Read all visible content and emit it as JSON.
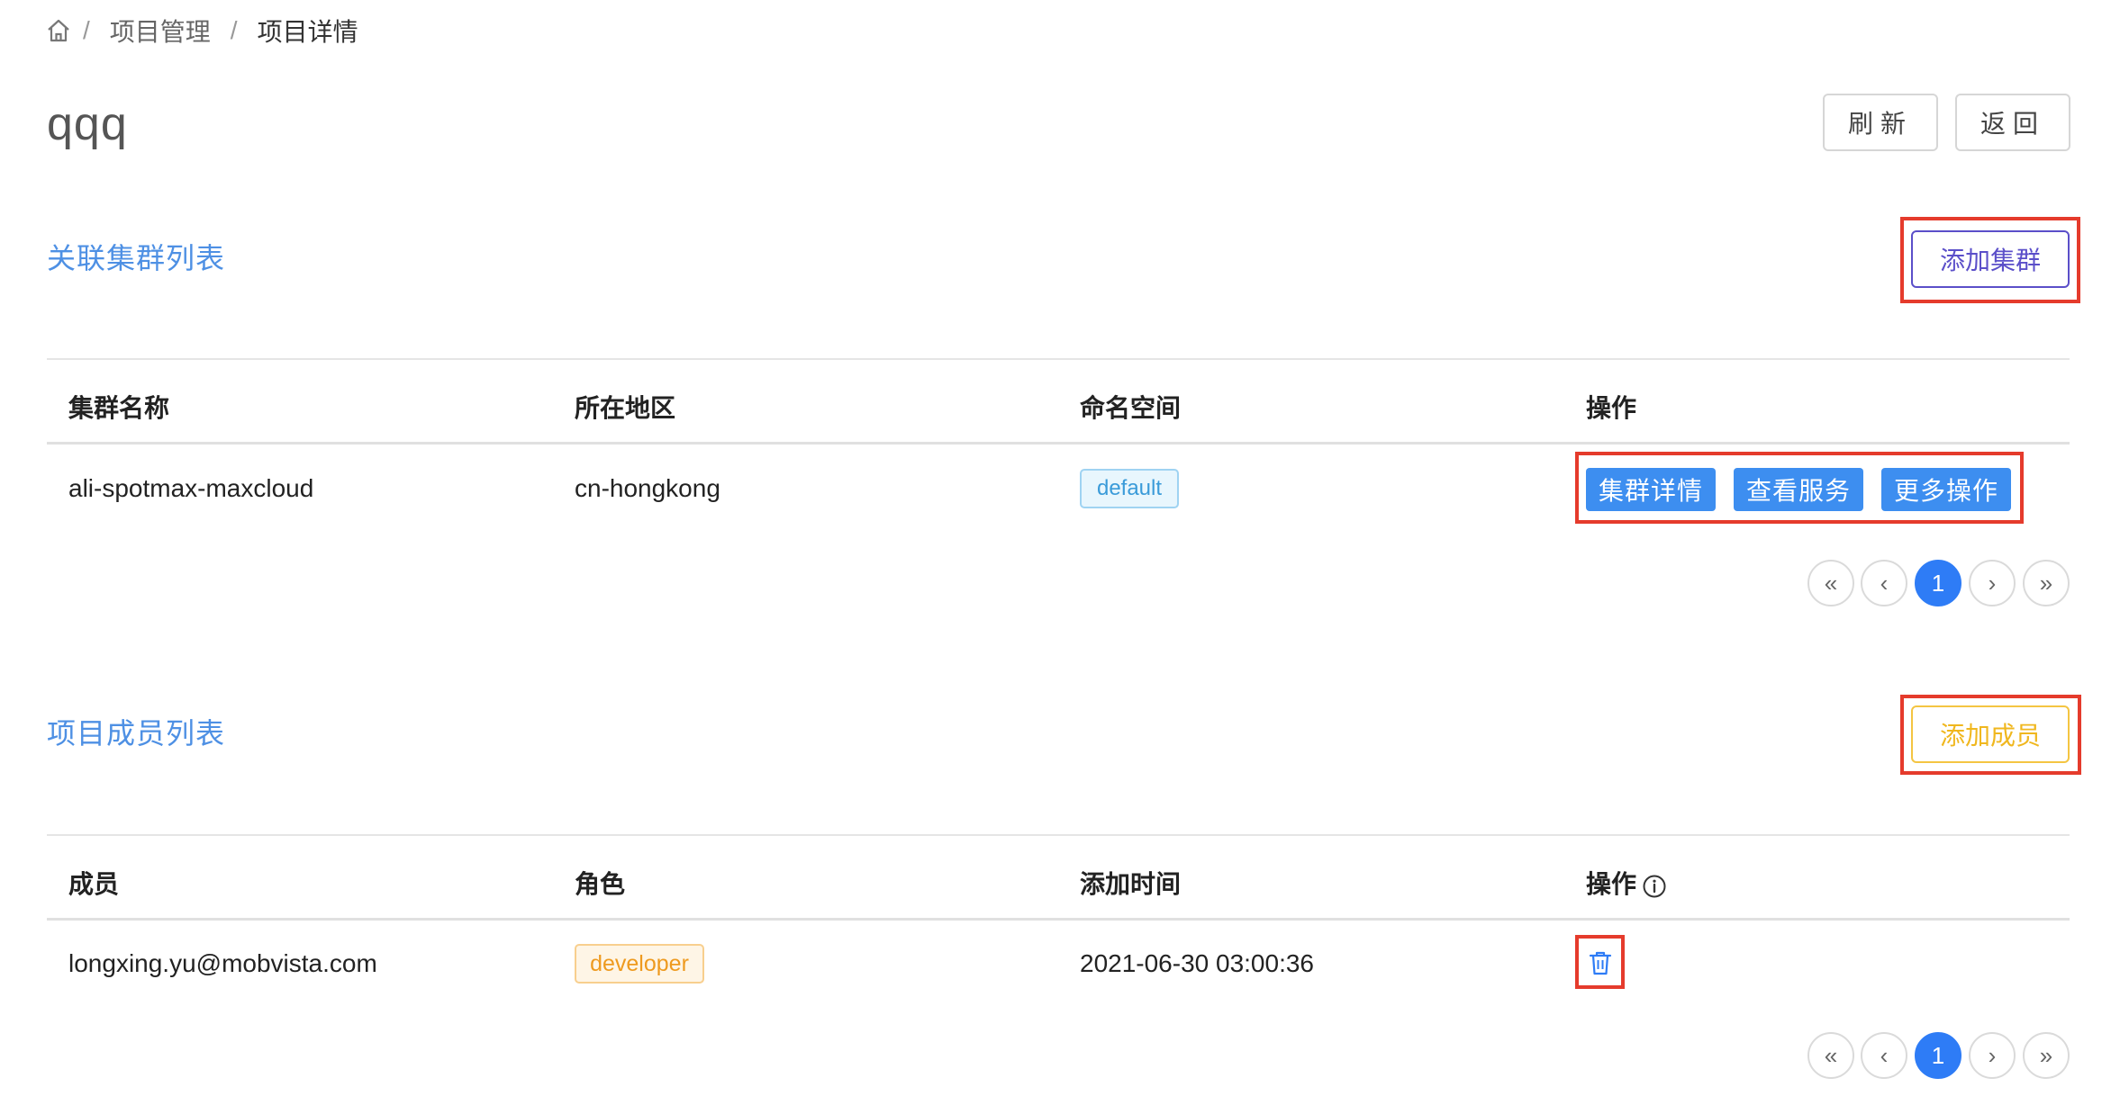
{
  "breadcrumb": {
    "items": [
      "项目管理",
      "项目详情"
    ]
  },
  "page": {
    "title": "qqq"
  },
  "header_buttons": {
    "refresh": "刷新",
    "back": "返回"
  },
  "cluster_section": {
    "title": "关联集群列表",
    "add_label": "添加集群",
    "columns": [
      "集群名称",
      "所在地区",
      "命名空间",
      "操作"
    ],
    "rows": [
      {
        "name": "ali-spotmax-maxcloud",
        "region": "cn-hongkong",
        "namespace": "default",
        "actions": [
          "集群详情",
          "查看服务",
          "更多操作"
        ]
      }
    ],
    "pager": {
      "first": "«",
      "prev": "‹",
      "current": "1",
      "next": "›",
      "last": "»"
    }
  },
  "member_section": {
    "title": "项目成员列表",
    "add_label": "添加成员",
    "columns": [
      "成员",
      "角色",
      "添加时间",
      "操作"
    ],
    "rows": [
      {
        "member": "longxing.yu@mobvista.com",
        "role": "developer",
        "added_at": "2021-06-30 03:00:36"
      }
    ],
    "pager": {
      "first": "«",
      "prev": "‹",
      "current": "1",
      "next": "›",
      "last": "»"
    }
  },
  "colors": {
    "primary": "#3d8ef0",
    "section_title": "#4e90e4",
    "highlight_frame": "#e53b2c",
    "add_cluster": "#5b4fc9",
    "add_member": "#f0b71e"
  },
  "icons": {
    "home": "home-icon",
    "info": "info-circle-icon",
    "delete": "trash-icon"
  }
}
